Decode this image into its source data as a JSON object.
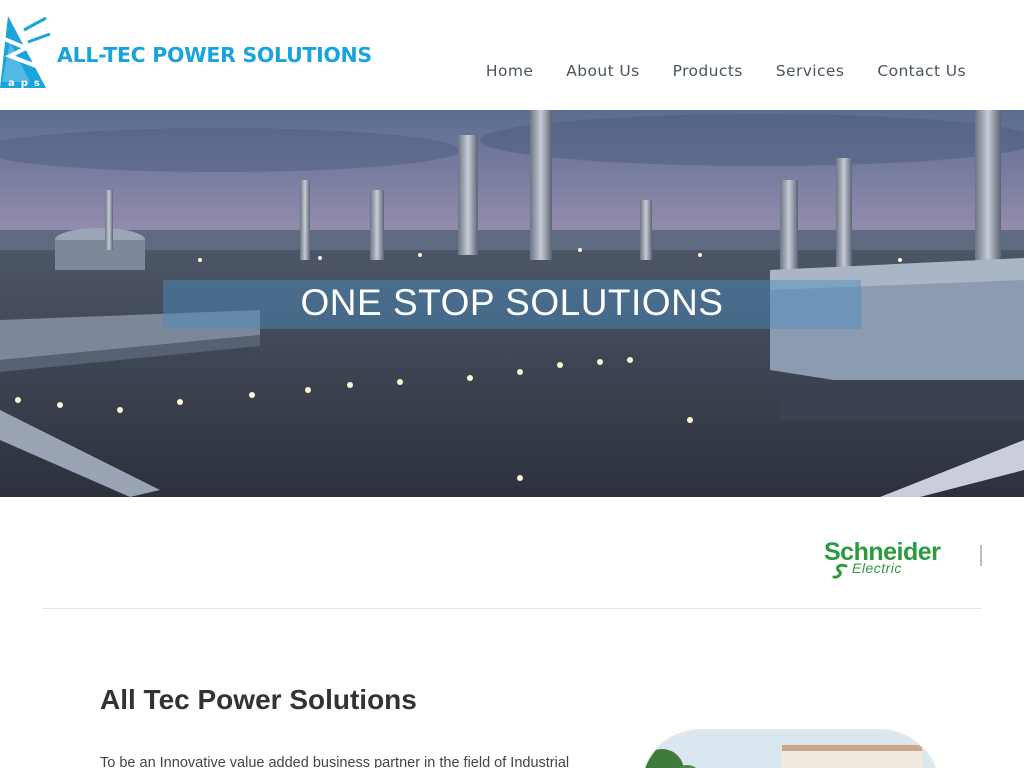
{
  "header": {
    "logo": {
      "text": "ALL-TEC POWER SOLUTIONS",
      "mark_letters": "aps",
      "icon": "logo-mark-icon",
      "color": "#1aa3dc"
    },
    "nav": [
      {
        "label": "Home"
      },
      {
        "label": "About Us"
      },
      {
        "label": "Products"
      },
      {
        "label": "Services"
      },
      {
        "label": "Contact Us"
      }
    ]
  },
  "hero": {
    "title": "ONE STOP SOLUTIONS",
    "image": "industrial-plant-at-dusk-image"
  },
  "partners": {
    "logos": [
      {
        "name": "Schneider",
        "subtitle": "Electric",
        "color": "#2c9a3f"
      }
    ]
  },
  "about": {
    "title": "All Tec Power Solutions",
    "text": "To be an Innovative value added business partner in the field of Industrial",
    "image": "building-photo"
  }
}
